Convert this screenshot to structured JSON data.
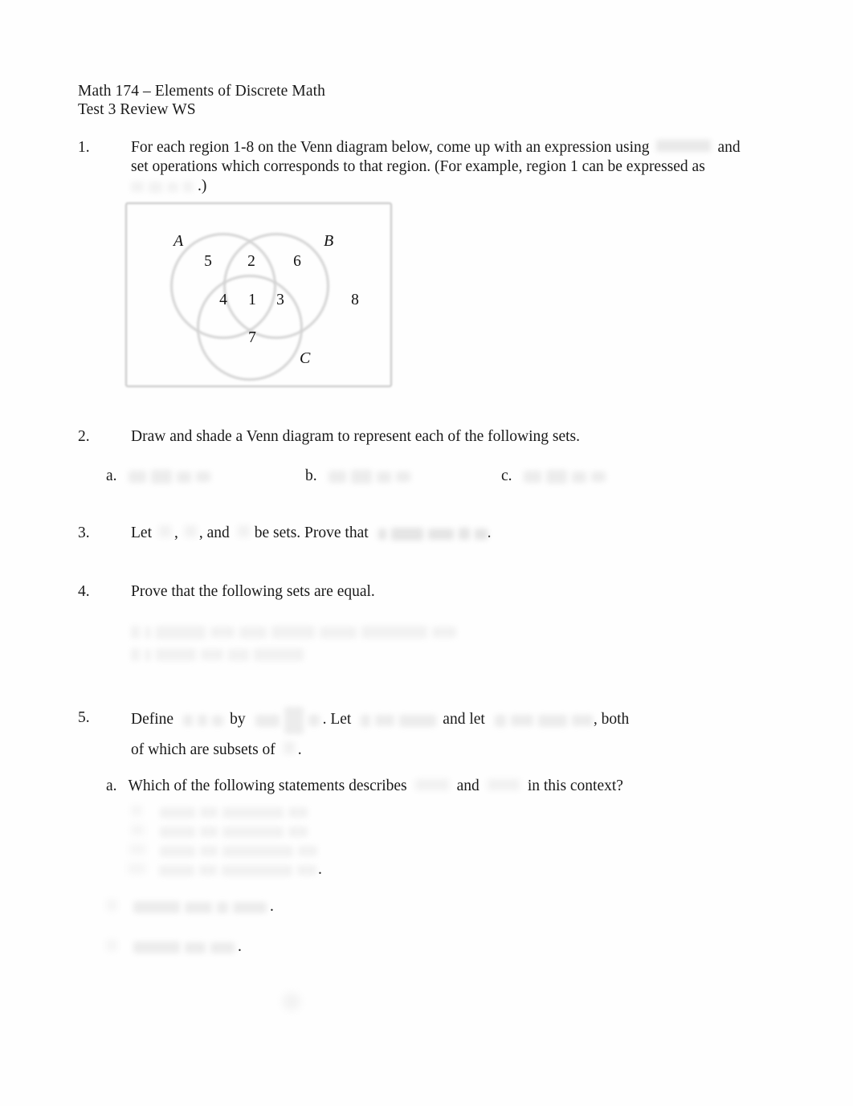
{
  "document": {
    "course_line": "Math 174 – Elements of Discrete Math",
    "title_line": "Test 3 Review WS"
  },
  "questions": [
    {
      "number": "1.",
      "text_before": "For each region 1-8 on the Venn diagram below, come up with an expression using",
      "text_middle": "and",
      "line2": "set operations which corresponds to that region.  (For example, region 1 can be expressed as",
      "line3_tail": ".)",
      "redacted": [
        "unrendered-expression",
        "unrendered-expression"
      ]
    },
    {
      "number": "2.",
      "text": "Draw and shade a Venn diagram to represent each of the following sets.",
      "parts": [
        {
          "label": "a.",
          "redacted": "unrendered-expression"
        },
        {
          "label": "b.",
          "redacted": "unrendered-expression"
        },
        {
          "label": "c.",
          "redacted": "unrendered-expression"
        }
      ]
    },
    {
      "number": "3.",
      "seg1": "Let",
      "seg2": ",",
      "seg3": ", and",
      "seg4": "be sets.  Prove that",
      "seg5": ".",
      "redacted": [
        "set-symbol",
        "set-symbol",
        "set-symbol",
        "unrendered-expression"
      ]
    },
    {
      "number": "4.",
      "text": "Prove that the following sets are equal.",
      "redacted": [
        "unrendered-set-builder-line-1",
        "unrendered-set-builder-line-2"
      ]
    },
    {
      "number": "5.",
      "seg1": "Define",
      "seg2": "by",
      "seg3": ".  Let",
      "seg4": "and let",
      "seg5": ", both",
      "line2a": "of which are subsets of",
      "line2b": ".",
      "redacted": [
        "function-name",
        "function-definition",
        "set-definition",
        "set-definition",
        "domain-symbol"
      ],
      "parts": [
        {
          "label": "a.",
          "text_before": "Which of the following statements describes",
          "text_middle": "and",
          "text_after": "in this context?",
          "redacted": [
            "symbol",
            "symbol"
          ],
          "choices": [
            {
              "marker": "i.",
              "redacted": "unrendered-statement"
            },
            {
              "marker": "ii.",
              "redacted": "unrendered-statement"
            },
            {
              "marker": "iii.",
              "redacted": "unrendered-statement"
            },
            {
              "marker": "iv.",
              "redacted": "unrendered-statement",
              "tail": "."
            }
          ]
        },
        {
          "label": "b.",
          "redacted": "unrendered-expression",
          "tail": "."
        },
        {
          "label": "c.",
          "redacted": "unrendered-expression",
          "tail": "."
        }
      ]
    }
  ],
  "venn": {
    "sets": [
      {
        "name": "A",
        "id": "venn-label-a"
      },
      {
        "name": "B",
        "id": "venn-label-b"
      },
      {
        "name": "C",
        "id": "venn-label-c"
      }
    ],
    "regions": [
      {
        "id": "venn-region-1",
        "number": "1"
      },
      {
        "id": "venn-region-2",
        "number": "2"
      },
      {
        "id": "venn-region-3",
        "number": "3"
      },
      {
        "id": "venn-region-4",
        "number": "4"
      },
      {
        "id": "venn-region-5",
        "number": "5"
      },
      {
        "id": "venn-region-6",
        "number": "6"
      },
      {
        "id": "venn-region-7",
        "number": "7"
      },
      {
        "id": "venn-region-8",
        "number": "8"
      }
    ]
  },
  "colors": {
    "page_background": "#fefefe",
    "text": "#1a1a1a",
    "diagram_stroke": "#d3d3d3",
    "redacted_block": "#d8d8d8"
  }
}
